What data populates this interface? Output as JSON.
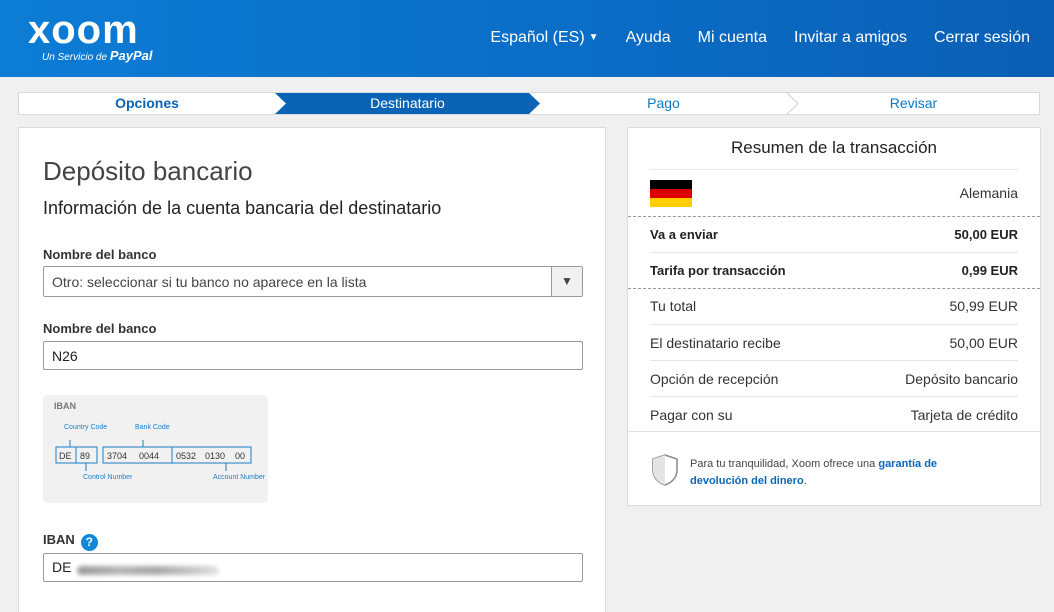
{
  "header": {
    "logo_text": "xoom",
    "logo_sub_prefix": "Un Servicio de",
    "logo_sub_brand": "PayPal",
    "nav": {
      "language": "Español (ES)",
      "help": "Ayuda",
      "account": "Mi cuenta",
      "invite": "Invitar a amigos",
      "logout": "Cerrar sesión"
    }
  },
  "steps": [
    {
      "label": "Opciones",
      "state": "done"
    },
    {
      "label": "Destinatario",
      "state": "active"
    },
    {
      "label": "Pago",
      "state": "pending"
    },
    {
      "label": "Revisar",
      "state": "pending"
    }
  ],
  "form": {
    "title": "Depósito bancario",
    "subtitle": "Información de la cuenta bancaria del destinatario",
    "bank_select_label": "Nombre del banco",
    "bank_select_value": "Otro: seleccionar si tu banco no aparece en la lista",
    "bank_name_label": "Nombre del banco",
    "bank_name_value": "N26",
    "iban_label": "IBAN",
    "iban_value_visible": "DE",
    "iban_help_icon": "?",
    "iban_example": {
      "title": "IBAN",
      "country_code_label": "Country Code",
      "bank_code_label": "Bank Code",
      "control_number_label": "Control Number",
      "account_number_label": "Account Number",
      "segments": [
        "DE",
        "89",
        "3704",
        "0044",
        "0532",
        "0130",
        "00"
      ]
    }
  },
  "summary": {
    "title": "Resumen de la transacción",
    "country": "Alemania",
    "rows": [
      {
        "key": "Va a enviar",
        "value": "50,00 EUR",
        "bold": true
      },
      {
        "key": "Tarifa por transacción",
        "value": "0,99 EUR",
        "bold": true
      },
      {
        "key": "Tu total",
        "value": "50,99 EUR",
        "bold": false
      },
      {
        "key": "El destinatario recibe",
        "value": "50,00 EUR",
        "bold": false
      },
      {
        "key": "Opción de recepción",
        "value": "Depósito bancario",
        "bold": false
      },
      {
        "key": "Pagar con su",
        "value": "Tarjeta de crédito",
        "bold": false
      }
    ],
    "guarantee_prefix": "Para tu tranquilidad, Xoom ofrece una",
    "guarantee_link": "garantía de devolución del dinero",
    "guarantee_suffix": "."
  },
  "colors": {
    "brand_blue": "#0a6dc6",
    "active_step": "#0a63b5",
    "link_blue": "#0b66b8",
    "help_icon_blue": "#1187d8"
  }
}
